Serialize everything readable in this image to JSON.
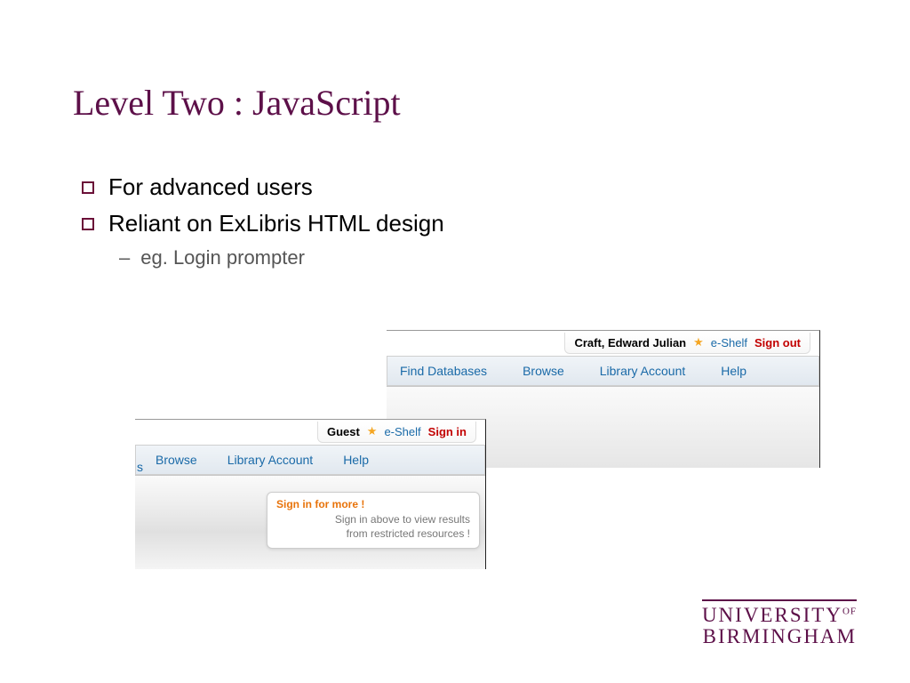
{
  "title": "Level Two : JavaScript",
  "bullets": {
    "b1": "For advanced users",
    "b2": "Reliant on ExLibris HTML design",
    "sub1": "eg. Login prompter"
  },
  "right": {
    "user": "Craft, Edward Julian",
    "eshelf": "e-Shelf",
    "signout": "Sign out",
    "nav": {
      "a": "Find Databases",
      "b": "Browse",
      "c": "Library Account",
      "d": "Help"
    }
  },
  "left": {
    "user": "Guest",
    "eshelf": "e-Shelf",
    "signin": "Sign in",
    "edge": "s",
    "nav": {
      "a": "Browse",
      "b": "Library Account",
      "c": "Help"
    },
    "prompt": {
      "title": "Sign in for more !",
      "line1": "Sign in above to view results",
      "line2": "from restricted resources !"
    }
  },
  "logo": {
    "l1pre": "UNIVERSITY",
    "l1suf": "OF",
    "l2": "BIRMINGHAM"
  }
}
